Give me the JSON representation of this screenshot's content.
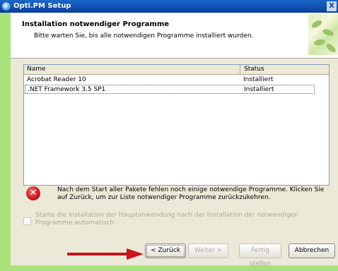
{
  "window": {
    "title": "Opti.PM Setup",
    "close_glyph": "X"
  },
  "header": {
    "title": "Installation notwendiger Programme",
    "subtitle": "Bitte warten Sie, bis alle notwendigen Programme installiert wurden."
  },
  "list": {
    "columns": [
      "Name",
      "Status"
    ],
    "rows": [
      {
        "name": "Acrobat Reader 10",
        "status": "Installiert"
      },
      {
        "name": ".NET Framework 3.5 SP1",
        "status": "Installiert"
      }
    ]
  },
  "message": "Nach dem Start aller Pakete fehlen noch einige notwendige Programme. Klicken Sie auf Zurück, um zur Liste notwendiger Programme zurückzukehren.",
  "error_glyph": "✕",
  "checkbox_label": "Starte die Installation der Hauptanwendung nach der Installation der notwendigen Programme automatisch.",
  "buttons": {
    "back": "< Zurück",
    "next": "Weiter >",
    "finish": "Fertig stellen",
    "cancel": "Abbrechen"
  },
  "colors": {
    "arrow": "#c8141b",
    "title_bar": "#0a3e9e",
    "background": "#a8e27a"
  }
}
